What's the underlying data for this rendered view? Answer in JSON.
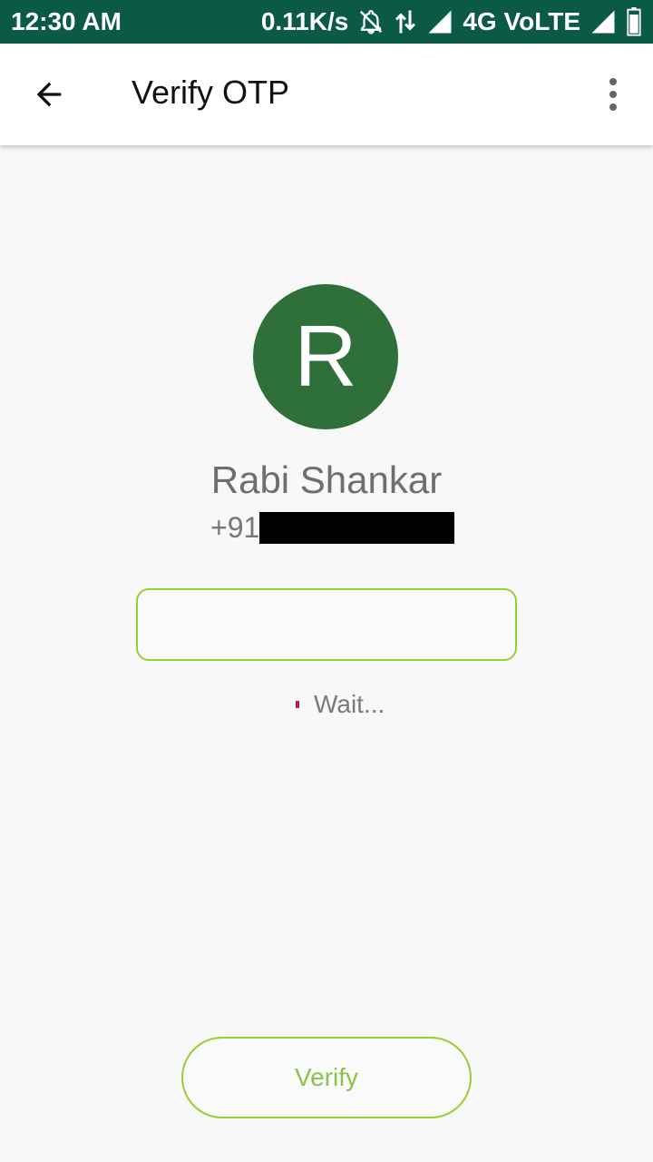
{
  "status_bar": {
    "time": "12:30 AM",
    "speed": "0.11K/s",
    "network": "4G VoLTE"
  },
  "app_bar": {
    "title": "Verify OTP"
  },
  "profile": {
    "initial": "R",
    "name": "Rabi Shankar",
    "phone_prefix": "+91"
  },
  "otp": {
    "value": "",
    "status": "Wait..."
  },
  "actions": {
    "verify_label": "Verify"
  },
  "colors": {
    "status_bar": "#0a5a46",
    "avatar": "#2e6f3a",
    "accent": "#9acd32",
    "spinner": "#c2185b"
  }
}
